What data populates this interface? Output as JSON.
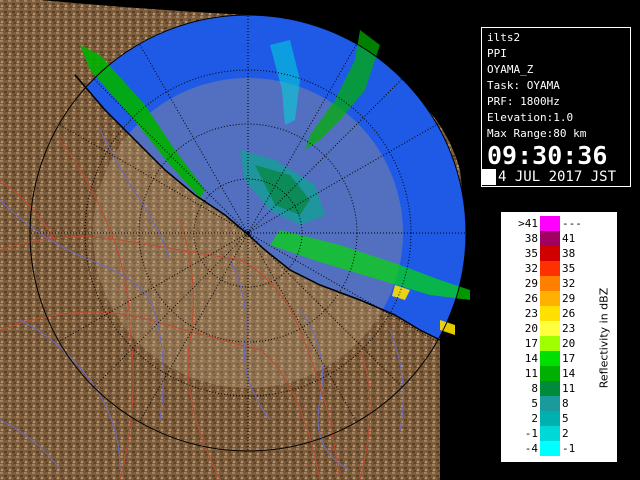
{
  "info": {
    "product": "ilts2",
    "scan_type": "PPI",
    "site": "OYAMA_Z",
    "task": "Task: OYAMA",
    "prf": "PRF: 1800Hz",
    "elevation": "Elevation:1.0",
    "max_range": "Max Range:80 km",
    "time": "09:30:36",
    "date": "4 JUL 2017 JST"
  },
  "legend": {
    "unit_label": "Reflectivity in dBZ",
    "rows": [
      {
        "left": ">41",
        "right": "---",
        "color": "#ff00ff"
      },
      {
        "left": "38",
        "right": "41",
        "color": "#a00060"
      },
      {
        "left": "35",
        "right": "38",
        "color": "#d00000"
      },
      {
        "left": "32",
        "right": "35",
        "color": "#ff3000"
      },
      {
        "left": "29",
        "right": "32",
        "color": "#ff8000"
      },
      {
        "left": "26",
        "right": "29",
        "color": "#ffb000"
      },
      {
        "left": "23",
        "right": "26",
        "color": "#ffe000"
      },
      {
        "left": "20",
        "right": "23",
        "color": "#ffff40"
      },
      {
        "left": "17",
        "right": "20",
        "color": "#a0ff00"
      },
      {
        "left": "14",
        "right": "17",
        "color": "#00e000"
      },
      {
        "left": "11",
        "right": "14",
        "color": "#00b000"
      },
      {
        "left": "8",
        "right": "11",
        "color": "#008a3a"
      },
      {
        "left": "5",
        "right": "8",
        "color": "#1a9a9a"
      },
      {
        "left": "2",
        "right": "5",
        "color": "#00b0b0"
      },
      {
        "left": "-1",
        "right": "2",
        "color": "#00d8d8"
      },
      {
        "left": "-4",
        "right": "-1",
        "color": "#00ffff"
      }
    ]
  },
  "colors": {
    "sea": "#1e5ae6",
    "land": "#7a5a3a",
    "land_light": "#b49a76",
    "rivers": "#6a6ac0",
    "borders": "#c04a30",
    "range_rings": "#000000"
  }
}
